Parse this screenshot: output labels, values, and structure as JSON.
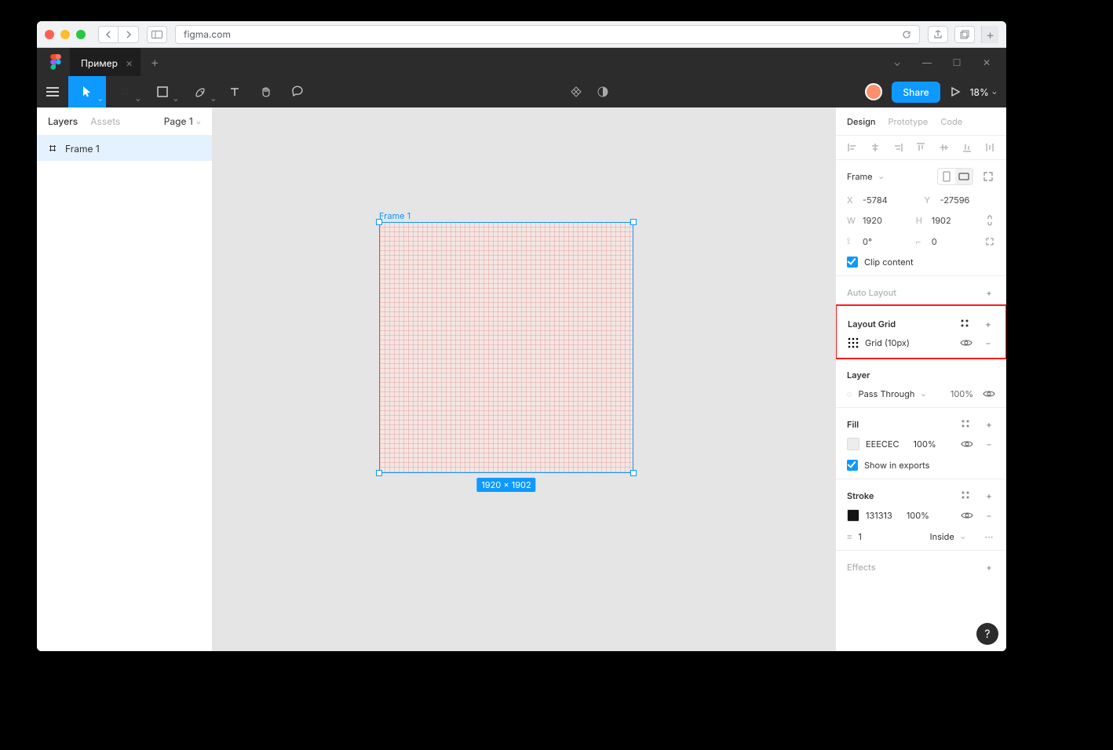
{
  "browser": {
    "url": "figma.com"
  },
  "tabs": {
    "file_name": "Пример"
  },
  "toolbar": {
    "share": "Share",
    "zoom": "18%"
  },
  "left_panel": {
    "tabs": {
      "layers": "Layers",
      "assets": "Assets"
    },
    "page_selector": "Page 1",
    "layers": [
      {
        "name": "Frame 1"
      }
    ]
  },
  "canvas": {
    "frame_label": "Frame 1",
    "dimensions_badge": "1920 × 1902"
  },
  "right_panel": {
    "tabs": {
      "design": "Design",
      "prototype": "Prototype",
      "code": "Code"
    },
    "frame": {
      "label": "Frame",
      "x_label": "X",
      "x": "-5784",
      "y_label": "Y",
      "y": "-27596",
      "w_label": "W",
      "w": "1920",
      "h_label": "H",
      "h": "1902",
      "rot_label": "⟲",
      "rot": "0°",
      "rad_label": "⌐",
      "rad": "0",
      "clip": "Clip content"
    },
    "auto_layout": {
      "title": "Auto Layout"
    },
    "layout_grid": {
      "title": "Layout Grid",
      "items": [
        {
          "label": "Grid (10px)"
        }
      ]
    },
    "layer": {
      "title": "Layer",
      "blend": "Pass Through",
      "opacity": "100%"
    },
    "fill": {
      "title": "Fill",
      "items": [
        {
          "hex": "EEECEC",
          "opacity": "100%",
          "swatch": "#eeecec"
        }
      ],
      "show_in_exports": "Show in exports"
    },
    "stroke": {
      "title": "Stroke",
      "items": [
        {
          "hex": "131313",
          "opacity": "100%",
          "swatch": "#131313"
        }
      ],
      "weight": "1",
      "align": "Inside"
    },
    "effects": {
      "title": "Effects"
    }
  }
}
